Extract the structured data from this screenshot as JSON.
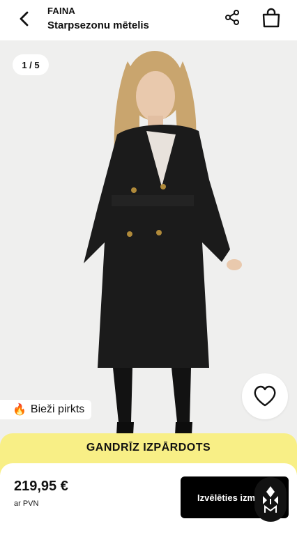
{
  "header": {
    "brand": "FAINA",
    "product_name": "Starpsezonu mētelis",
    "back_icon": "chevron-left-icon",
    "share_icon": "share-icon",
    "bag_icon": "shopping-bag-icon"
  },
  "gallery": {
    "counter": "1 / 5",
    "badge_emoji": "🔥",
    "badge_text": "Bieži pirkts",
    "wish_icon": "heart-icon",
    "image": "product photo: model wearing long black trench coat"
  },
  "banner": {
    "text": "GANDRĪZ IZPĀRDOTS",
    "color": "#f8ef86"
  },
  "purchase": {
    "price": "219,95 €",
    "vat_note": "ar PVN",
    "select_label": "Izvēlēties izmēru"
  },
  "colors": {
    "accent_button": "#000000",
    "banner_yellow": "#f8ef86",
    "gallery_bg": "#f0f0ef"
  }
}
